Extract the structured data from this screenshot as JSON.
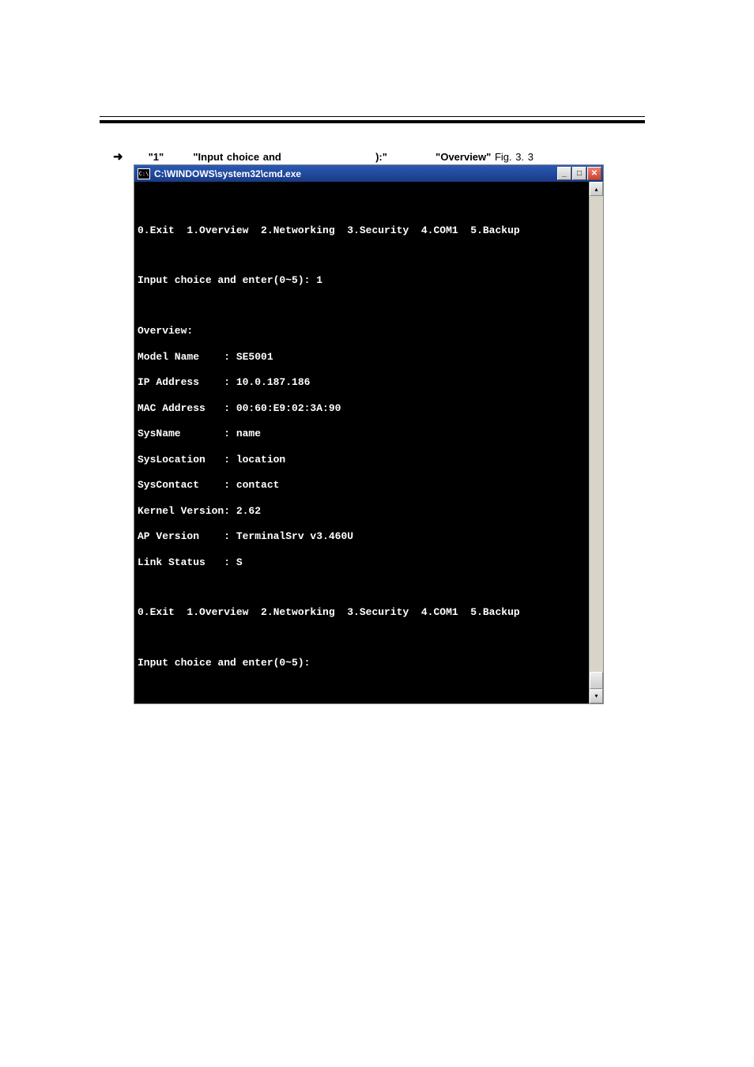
{
  "intro": {
    "arrow": "➜",
    "q1_pre": "",
    "q1": "\"1\"",
    "gap1": "",
    "bold1": "\"Input choice and",
    "gap2": "):\"",
    "bold2": "\"Overview\"",
    "fig_ref": "Fig. 3. 3"
  },
  "terminal": {
    "title_icon": "C:\\",
    "title": "C:\\WINDOWS\\system32\\cmd.exe",
    "btn_min": "_",
    "btn_max": "□",
    "btn_close": "✕",
    "scroll_up": "▴",
    "scroll_down": "▾",
    "lines": {
      "menu1": "0.Exit  1.Overview  2.Networking  3.Security  4.COM1  5.Backup",
      "prompt1": "Input choice and enter(0~5): 1",
      "hdr": "Overview:",
      "r1": "Model Name    : SE5001",
      "r2": "IP Address    : 10.0.187.186",
      "r3": "MAC Address   : 00:60:E9:02:3A:90",
      "r4": "SysName       : name",
      "r5": "SysLocation   : location",
      "r6": "SysContact    : contact",
      "r7": "Kernel Version: 2.62",
      "r8": "AP Version    : TerminalSrv v3.460U",
      "r9": "Link Status   : S",
      "menu2": "0.Exit  1.Overview  2.Networking  3.Security  4.COM1  5.Backup",
      "prompt2": "Input choice and enter(0~5):"
    }
  },
  "caption": "Fig. 3. 3"
}
